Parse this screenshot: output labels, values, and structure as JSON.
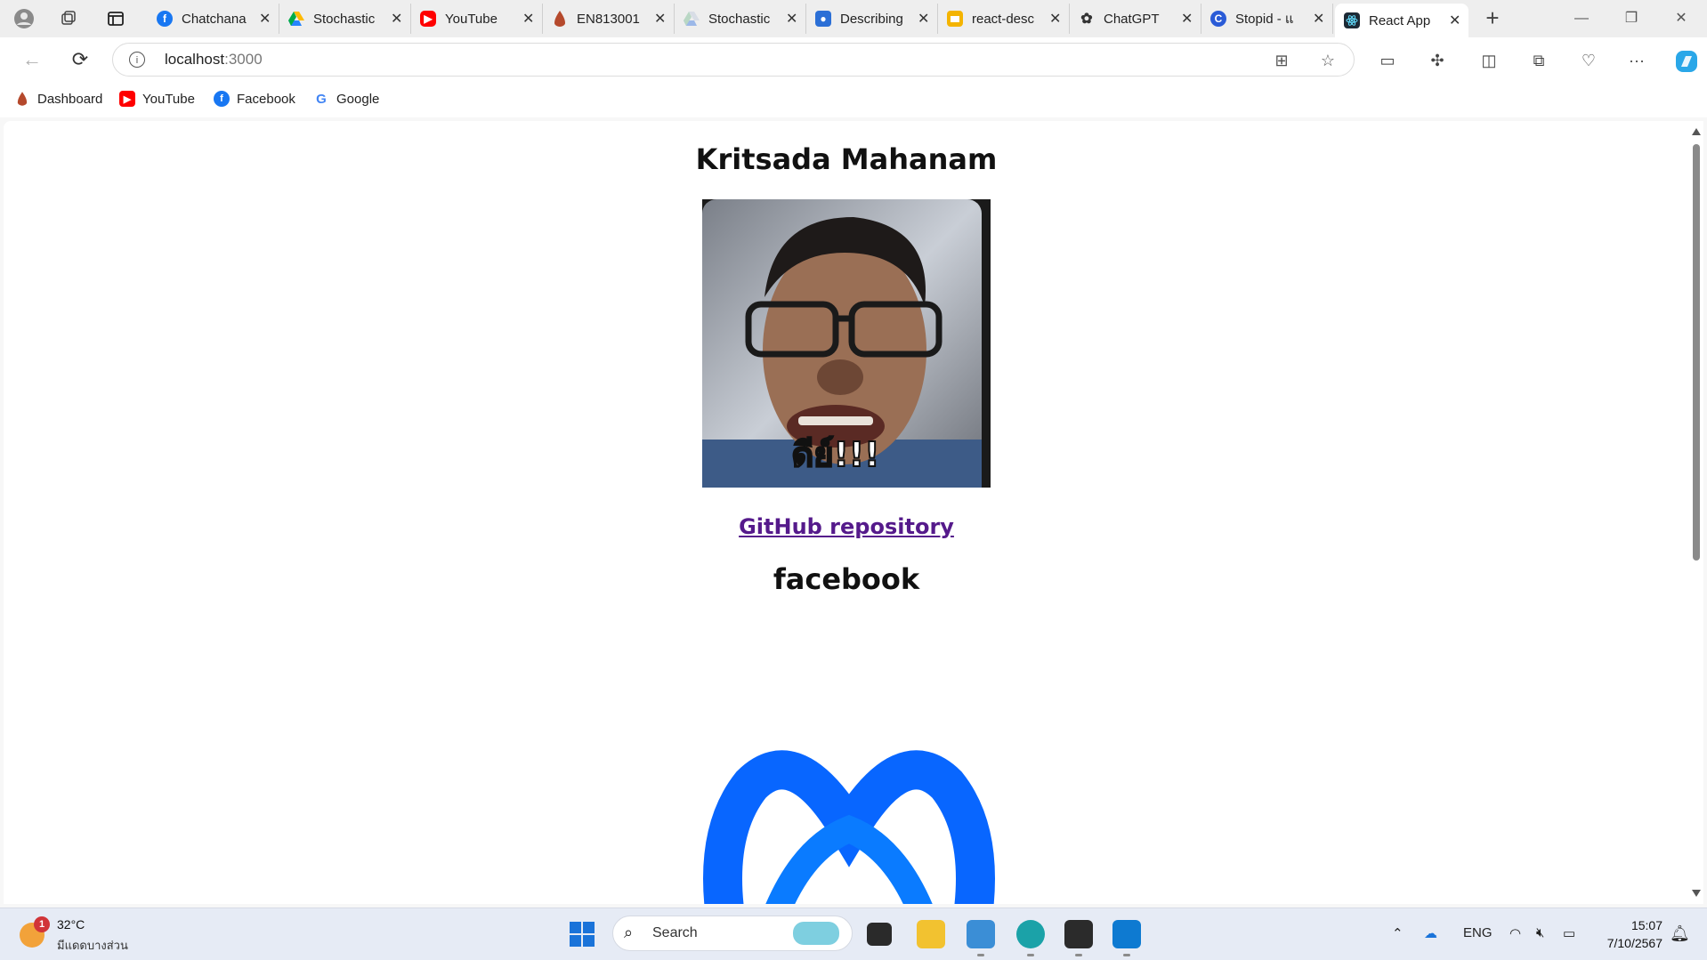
{
  "tabs": [
    {
      "title": "Chatchana",
      "icon": "facebook-icon",
      "color": "#1877f2"
    },
    {
      "title": "Stochastic",
      "icon": "google-drive-icon",
      "color": "#1fa463"
    },
    {
      "title": "YouTube",
      "icon": "youtube-icon",
      "color": "#ff0000"
    },
    {
      "title": "EN813001",
      "icon": "moodle-icon",
      "color": "#b5492c"
    },
    {
      "title": "Stochastic",
      "icon": "google-drive-icon",
      "color": "#9cb8e8"
    },
    {
      "title": "Describing",
      "icon": "classroom-icon",
      "color": "#2b6fd6"
    },
    {
      "title": "react-desc",
      "icon": "slides-icon",
      "color": "#f4b400"
    },
    {
      "title": "ChatGPT",
      "icon": "openai-icon",
      "color": "#444444"
    },
    {
      "title": "Stopid - แ",
      "icon": "copilot-icon",
      "color": "#2a5bd7"
    },
    {
      "title": "React App",
      "icon": "react-icon",
      "color": "#1d2a36"
    }
  ],
  "address": {
    "host": "localhost",
    "port": ":3000"
  },
  "bookmarks": [
    {
      "label": "Dashboard",
      "icon": "moodle-icon",
      "color": "#b5492c"
    },
    {
      "label": "YouTube",
      "icon": "youtube-icon",
      "color": "#ff0000"
    },
    {
      "label": "Facebook",
      "icon": "facebook-icon",
      "color": "#1877f2"
    },
    {
      "label": "Google",
      "icon": "google-icon",
      "color": "#4285f4"
    }
  ],
  "page": {
    "heading": "Kritsada Mahanam",
    "photo_caption": "ดีย์!!!",
    "repo_link": "GitHub repository",
    "fb_heading": "facebook"
  },
  "taskbar": {
    "weather_badge": "1",
    "temperature": "32°C",
    "weather_desc": "มีแดดบางส่วน",
    "search_placeholder": "Search",
    "language": "ENG",
    "time": "15:07",
    "date": "7/10/2567"
  },
  "colors": {
    "link": "#551a8b",
    "meta_blue": "#0866ff",
    "tab_strip": "#eeeeee"
  }
}
